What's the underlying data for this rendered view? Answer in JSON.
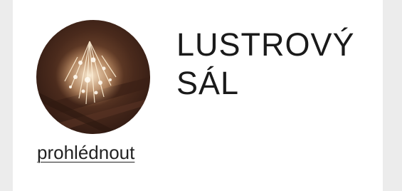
{
  "card": {
    "title_line1": "LUSTROVÝ",
    "title_line2": "SÁL",
    "link_label": "prohlédnout",
    "image_subject": "chandelier-photo"
  },
  "colors": {
    "page_background": "#ececec",
    "card_background": "#ffffff",
    "text": "#1a1a1a"
  }
}
